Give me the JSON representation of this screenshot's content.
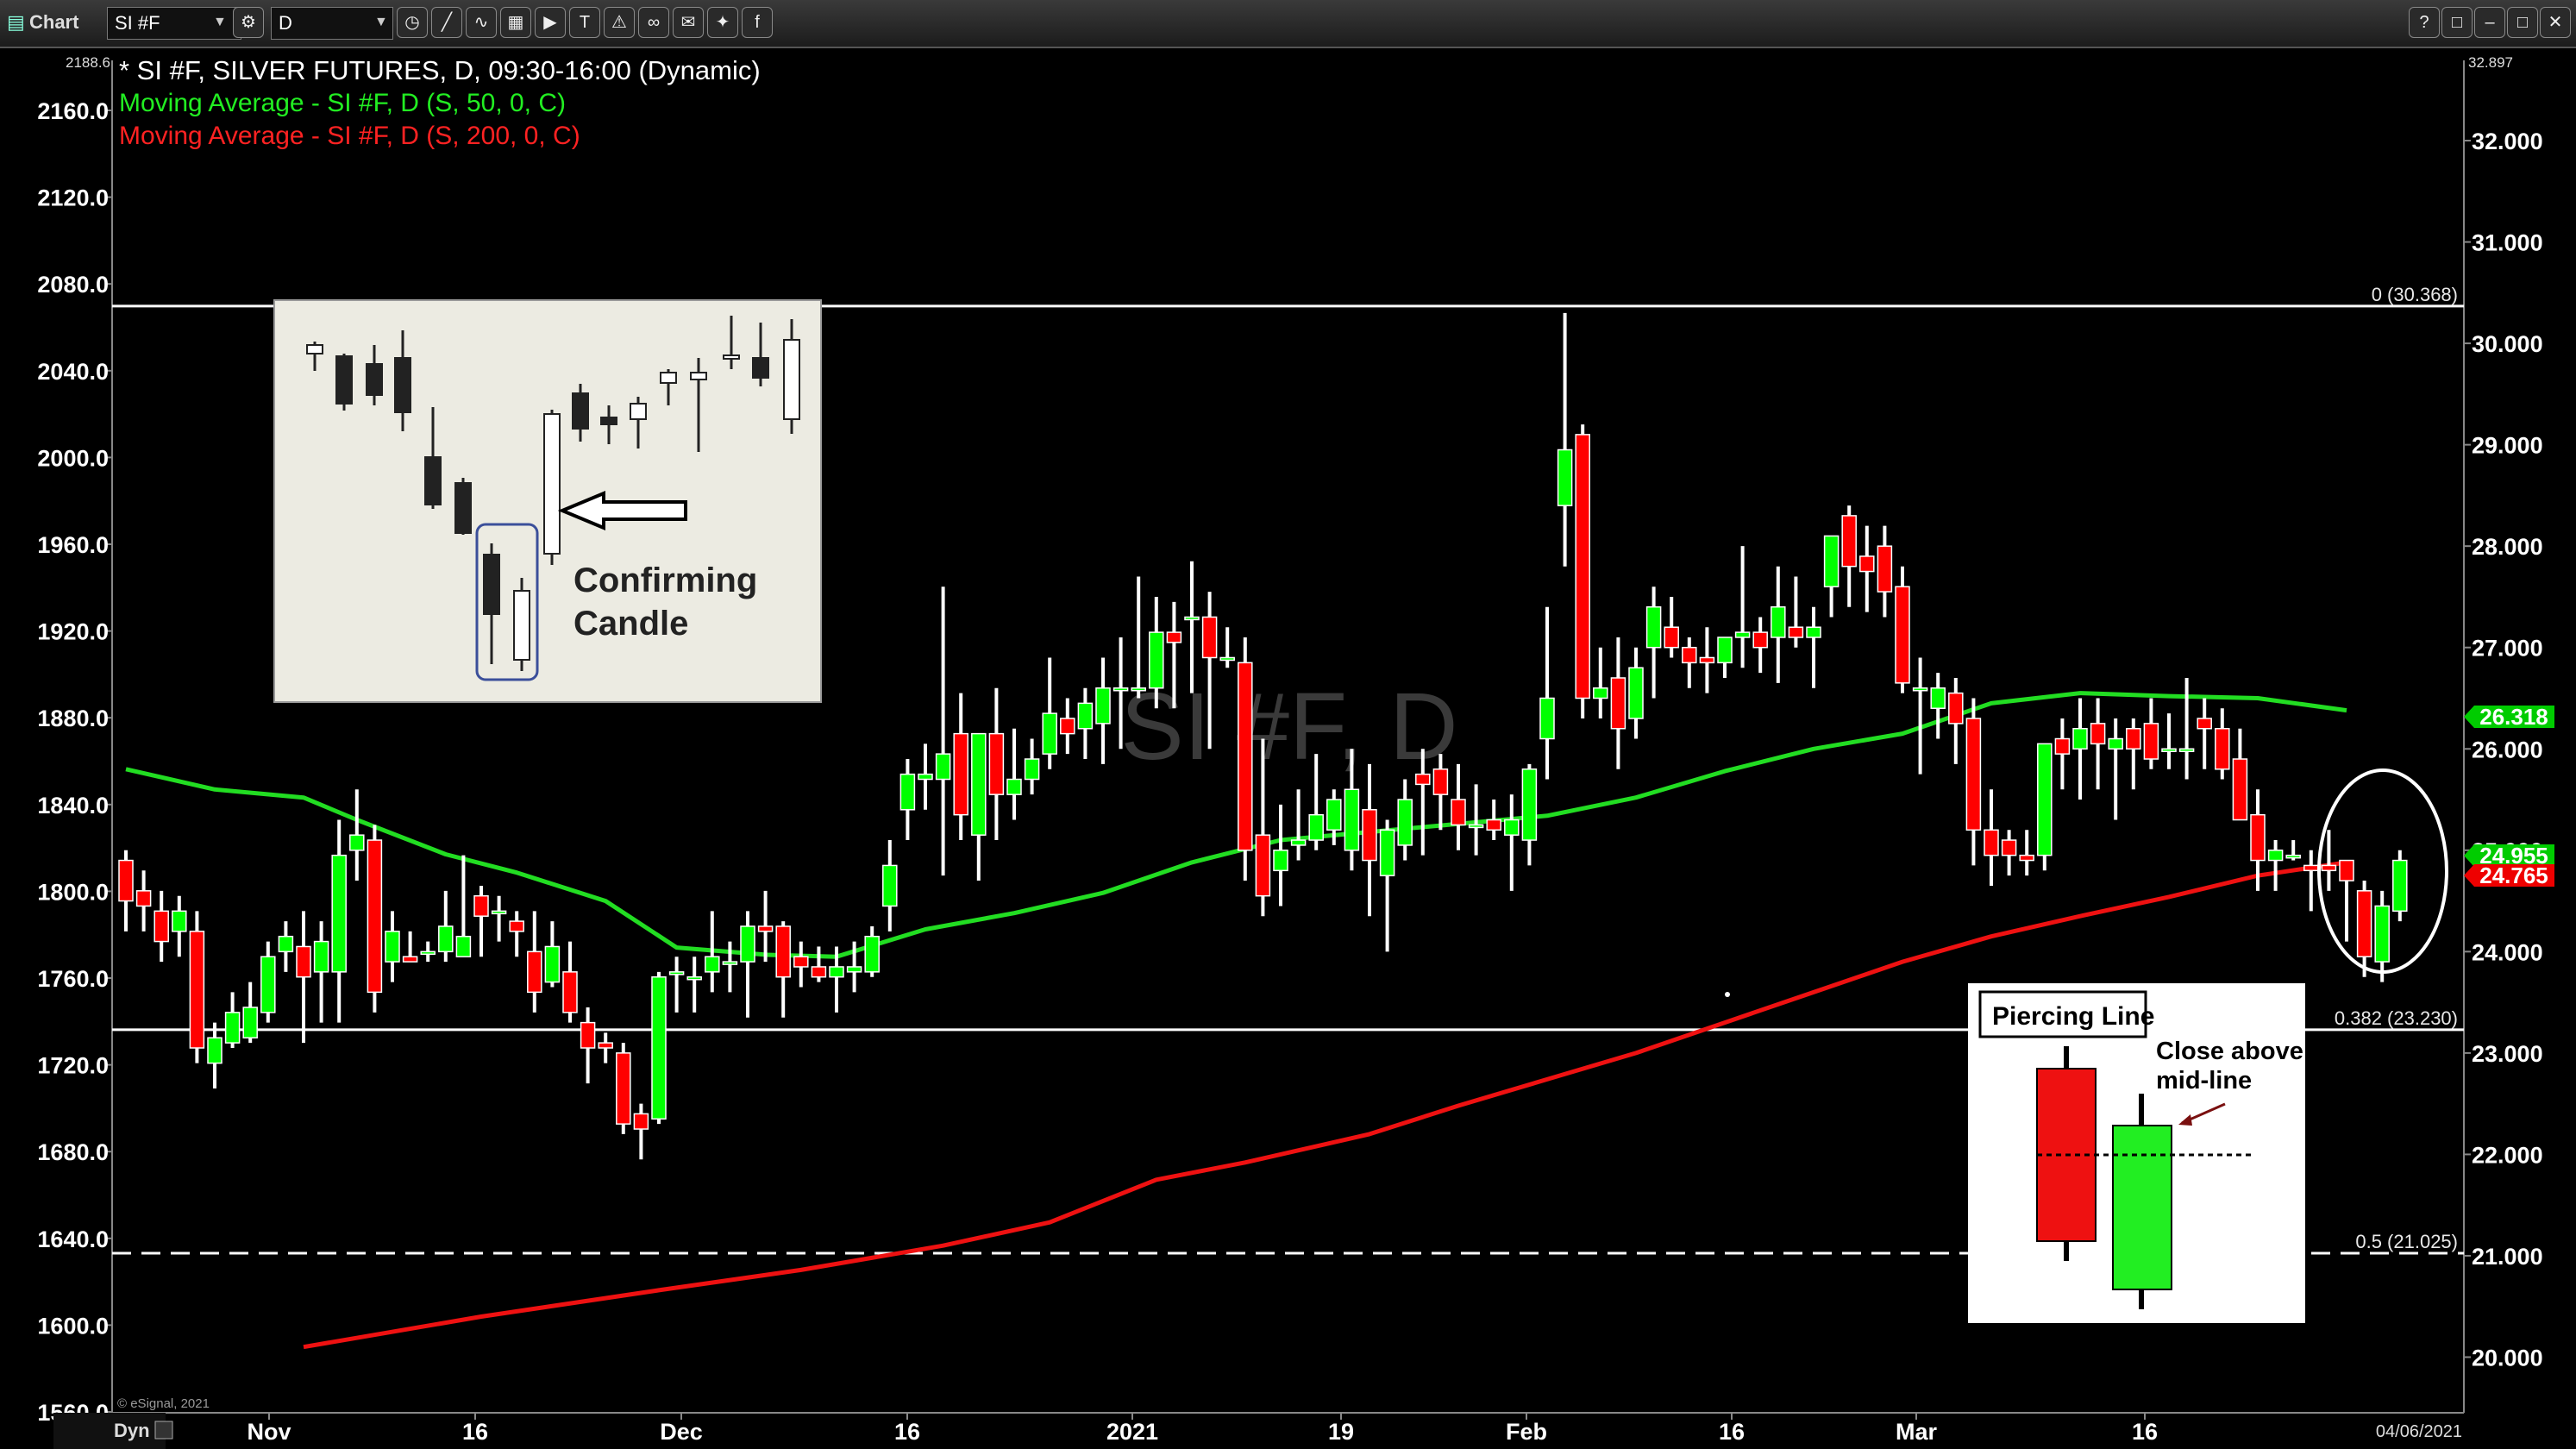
{
  "toolbar": {
    "app_label": "Chart",
    "symbol_value": "SI #F",
    "interval_value": "D",
    "window_controls": [
      "?",
      "□",
      "–",
      "□",
      "✕"
    ]
  },
  "header": {
    "title": "* SI #F, SILVER FUTURES, D, 09:30-16:00 (Dynamic)",
    "ma50": "Moving Average - SI #F, D (S, 50, 0, C)",
    "ma200": "Moving Average - SI #F, D (S, 200, 0, C)"
  },
  "watermark": "SI #F, D",
  "copyright": "© eSignal, 2021",
  "corner_label": "Dyn",
  "colors": {
    "up": "#00ff00",
    "down": "#ff0000",
    "ma50": "#22dd22",
    "ma200": "#ee1111",
    "white": "#ffffff"
  },
  "chart_data": {
    "type": "candlestick",
    "left_axis": {
      "ticks": [
        "2160.0",
        "2120.0",
        "2080.0",
        "2040.0",
        "2000.0",
        "1960.0",
        "1920.0",
        "1880.0",
        "1840.0",
        "1800.0",
        "1760.0",
        "1720.0",
        "1680.0",
        "1640.0",
        "1600.0",
        "1560.0"
      ],
      "top_label": "2188.6"
    },
    "right_axis": {
      "ticks": [
        "32.000",
        "31.000",
        "30.000",
        "29.000",
        "28.000",
        "27.000",
        "26.000",
        "25.000",
        "24.000",
        "23.000",
        "22.000",
        "21.000",
        "20.000"
      ],
      "top_label": "32.897",
      "ylim": [
        19.74,
        32.897
      ]
    },
    "x_axis": [
      "Nov",
      "16",
      "Dec",
      "16",
      "2021",
      "19",
      "Feb",
      "16",
      "Mar",
      "16"
    ],
    "date_label": "04/06/2021",
    "fib_levels": [
      {
        "label": "0 (30.368)",
        "value": 30.368,
        "style": "solid"
      },
      {
        "label": "0.382 (23.230)",
        "value": 23.23,
        "style": "solid"
      },
      {
        "label": "0.5 (21.025)",
        "value": 21.025,
        "style": "dashed"
      }
    ],
    "price_tags": [
      {
        "label": "26.318",
        "value": 26.318,
        "color": "#00cc00"
      },
      {
        "label": "24.955",
        "value": 24.955,
        "color": "#00cc00"
      },
      {
        "label": "24.765",
        "value": 24.765,
        "color": "#ee0000"
      }
    ],
    "candles": [
      {
        "o": 24.9,
        "h": 25.0,
        "l": 24.2,
        "c": 24.5
      },
      {
        "o": 24.6,
        "h": 24.8,
        "l": 24.2,
        "c": 24.45
      },
      {
        "o": 24.4,
        "h": 24.6,
        "l": 23.9,
        "c": 24.1
      },
      {
        "o": 24.2,
        "h": 24.55,
        "l": 23.95,
        "c": 24.4
      },
      {
        "o": 24.2,
        "h": 24.4,
        "l": 22.9,
        "c": 23.05
      },
      {
        "o": 22.9,
        "h": 23.3,
        "l": 22.65,
        "c": 23.15
      },
      {
        "o": 23.1,
        "h": 23.6,
        "l": 23.05,
        "c": 23.4
      },
      {
        "o": 23.15,
        "h": 23.7,
        "l": 23.1,
        "c": 23.45
      },
      {
        "o": 23.4,
        "h": 24.1,
        "l": 23.3,
        "c": 23.95
      },
      {
        "o": 24.0,
        "h": 24.3,
        "l": 23.8,
        "c": 24.15
      },
      {
        "o": 24.05,
        "h": 24.4,
        "l": 23.1,
        "c": 23.75
      },
      {
        "o": 23.8,
        "h": 24.3,
        "l": 23.3,
        "c": 24.1
      },
      {
        "o": 23.8,
        "h": 25.3,
        "l": 23.3,
        "c": 24.95
      },
      {
        "o": 25.0,
        "h": 25.6,
        "l": 24.7,
        "c": 25.15
      },
      {
        "o": 25.1,
        "h": 25.25,
        "l": 23.4,
        "c": 23.6
      },
      {
        "o": 23.9,
        "h": 24.4,
        "l": 23.7,
        "c": 24.2
      },
      {
        "o": 23.95,
        "h": 24.2,
        "l": 23.9,
        "c": 23.9
      },
      {
        "o": 24.0,
        "h": 24.1,
        "l": 23.9,
        "c": 24.0
      },
      {
        "o": 24.0,
        "h": 24.6,
        "l": 23.9,
        "c": 24.25
      },
      {
        "o": 23.95,
        "h": 24.95,
        "l": 23.95,
        "c": 24.15
      },
      {
        "o": 24.55,
        "h": 24.65,
        "l": 23.95,
        "c": 24.35
      },
      {
        "o": 24.4,
        "h": 24.55,
        "l": 24.1,
        "c": 24.4
      },
      {
        "o": 24.3,
        "h": 24.4,
        "l": 23.95,
        "c": 24.2
      },
      {
        "o": 24.0,
        "h": 24.4,
        "l": 23.4,
        "c": 23.6
      },
      {
        "o": 23.7,
        "h": 24.3,
        "l": 23.65,
        "c": 24.05
      },
      {
        "o": 23.8,
        "h": 24.1,
        "l": 23.3,
        "c": 23.4
      },
      {
        "o": 23.3,
        "h": 23.45,
        "l": 22.7,
        "c": 23.05
      },
      {
        "o": 23.1,
        "h": 23.2,
        "l": 22.9,
        "c": 23.05
      },
      {
        "o": 23.0,
        "h": 23.1,
        "l": 22.2,
        "c": 22.3
      },
      {
        "o": 22.4,
        "h": 22.5,
        "l": 21.95,
        "c": 22.25
      },
      {
        "o": 22.35,
        "h": 23.8,
        "l": 22.3,
        "c": 23.75
      },
      {
        "o": 23.8,
        "h": 23.95,
        "l": 23.4,
        "c": 23.8
      },
      {
        "o": 23.75,
        "h": 23.95,
        "l": 23.4,
        "c": 23.75
      },
      {
        "o": 23.8,
        "h": 24.4,
        "l": 23.6,
        "c": 23.95
      },
      {
        "o": 23.9,
        "h": 24.1,
        "l": 23.6,
        "c": 23.9
      },
      {
        "o": 23.9,
        "h": 24.4,
        "l": 23.35,
        "c": 24.25
      },
      {
        "o": 24.25,
        "h": 24.6,
        "l": 23.9,
        "c": 24.2
      },
      {
        "o": 24.25,
        "h": 24.3,
        "l": 23.35,
        "c": 23.75
      },
      {
        "o": 23.95,
        "h": 24.1,
        "l": 23.65,
        "c": 23.85
      },
      {
        "o": 23.85,
        "h": 24.05,
        "l": 23.7,
        "c": 23.75
      },
      {
        "o": 23.75,
        "h": 24.05,
        "l": 23.4,
        "c": 23.85
      },
      {
        "o": 23.8,
        "h": 24.1,
        "l": 23.6,
        "c": 23.85
      },
      {
        "o": 23.8,
        "h": 24.25,
        "l": 23.75,
        "c": 24.15
      },
      {
        "o": 24.45,
        "h": 25.1,
        "l": 24.2,
        "c": 24.85
      },
      {
        "o": 25.4,
        "h": 25.9,
        "l": 25.1,
        "c": 25.75
      },
      {
        "o": 25.7,
        "h": 26.05,
        "l": 25.4,
        "c": 25.75
      },
      {
        "o": 25.7,
        "h": 27.6,
        "l": 24.75,
        "c": 25.95
      },
      {
        "o": 26.15,
        "h": 26.55,
        "l": 25.1,
        "c": 25.35
      },
      {
        "o": 25.15,
        "h": 25.95,
        "l": 24.7,
        "c": 26.15
      },
      {
        "o": 26.15,
        "h": 26.6,
        "l": 25.1,
        "c": 25.55
      },
      {
        "o": 25.55,
        "h": 26.2,
        "l": 25.3,
        "c": 25.7
      },
      {
        "o": 25.7,
        "h": 26.1,
        "l": 25.55,
        "c": 25.9
      },
      {
        "o": 25.95,
        "h": 26.9,
        "l": 25.8,
        "c": 26.35
      },
      {
        "o": 26.3,
        "h": 26.5,
        "l": 25.95,
        "c": 26.15
      },
      {
        "o": 26.2,
        "h": 26.6,
        "l": 25.9,
        "c": 26.45
      },
      {
        "o": 26.25,
        "h": 26.9,
        "l": 25.85,
        "c": 26.6
      },
      {
        "o": 26.6,
        "h": 27.1,
        "l": 26.0,
        "c": 26.6
      },
      {
        "o": 26.6,
        "h": 27.7,
        "l": 26.5,
        "c": 26.6
      },
      {
        "o": 26.6,
        "h": 27.5,
        "l": 26.4,
        "c": 27.15
      },
      {
        "o": 27.15,
        "h": 27.45,
        "l": 26.4,
        "c": 27.05
      },
      {
        "o": 27.3,
        "h": 27.85,
        "l": 26.55,
        "c": 27.3
      },
      {
        "o": 27.3,
        "h": 27.55,
        "l": 26.0,
        "c": 26.9
      },
      {
        "o": 26.9,
        "h": 27.2,
        "l": 26.8,
        "c": 26.9
      },
      {
        "o": 26.85,
        "h": 27.1,
        "l": 24.7,
        "c": 25.0
      },
      {
        "o": 25.15,
        "h": 26.1,
        "l": 24.35,
        "c": 24.55
      },
      {
        "o": 24.8,
        "h": 25.45,
        "l": 24.45,
        "c": 25.0
      },
      {
        "o": 25.05,
        "h": 25.6,
        "l": 24.9,
        "c": 25.1
      },
      {
        "o": 25.1,
        "h": 25.95,
        "l": 25.0,
        "c": 25.35
      },
      {
        "o": 25.2,
        "h": 25.6,
        "l": 25.05,
        "c": 25.5
      },
      {
        "o": 25.0,
        "h": 26.0,
        "l": 24.8,
        "c": 25.6
      },
      {
        "o": 25.4,
        "h": 25.85,
        "l": 24.35,
        "c": 24.9
      },
      {
        "o": 24.75,
        "h": 25.3,
        "l": 24.0,
        "c": 25.2
      },
      {
        "o": 25.05,
        "h": 25.7,
        "l": 24.9,
        "c": 25.5
      },
      {
        "o": 25.75,
        "h": 26.0,
        "l": 24.95,
        "c": 25.65
      },
      {
        "o": 25.8,
        "h": 25.95,
        "l": 25.2,
        "c": 25.55
      },
      {
        "o": 25.5,
        "h": 25.85,
        "l": 25.0,
        "c": 25.25
      },
      {
        "o": 25.25,
        "h": 25.65,
        "l": 24.95,
        "c": 25.25
      },
      {
        "o": 25.3,
        "h": 25.5,
        "l": 25.1,
        "c": 25.2
      },
      {
        "o": 25.15,
        "h": 25.55,
        "l": 24.6,
        "c": 25.3
      },
      {
        "o": 25.1,
        "h": 25.85,
        "l": 24.85,
        "c": 25.8
      },
      {
        "o": 26.1,
        "h": 27.4,
        "l": 25.7,
        "c": 26.5
      },
      {
        "o": 28.4,
        "h": 30.3,
        "l": 27.8,
        "c": 28.95
      },
      {
        "o": 29.1,
        "h": 29.2,
        "l": 26.3,
        "c": 26.5
      },
      {
        "o": 26.5,
        "h": 27.0,
        "l": 26.3,
        "c": 26.6
      },
      {
        "o": 26.7,
        "h": 27.1,
        "l": 25.8,
        "c": 26.2
      },
      {
        "o": 26.3,
        "h": 27.0,
        "l": 26.1,
        "c": 26.8
      },
      {
        "o": 27.0,
        "h": 27.6,
        "l": 26.5,
        "c": 27.4
      },
      {
        "o": 27.2,
        "h": 27.5,
        "l": 26.9,
        "c": 27.0
      },
      {
        "o": 27.0,
        "h": 27.1,
        "l": 26.6,
        "c": 26.85
      },
      {
        "o": 26.9,
        "h": 27.2,
        "l": 26.55,
        "c": 26.85
      },
      {
        "o": 26.85,
        "h": 27.1,
        "l": 26.7,
        "c": 27.1
      },
      {
        "o": 27.1,
        "h": 28.0,
        "l": 26.8,
        "c": 27.15
      },
      {
        "o": 27.15,
        "h": 27.3,
        "l": 26.75,
        "c": 27.0
      },
      {
        "o": 27.1,
        "h": 27.8,
        "l": 26.65,
        "c": 27.4
      },
      {
        "o": 27.2,
        "h": 27.7,
        "l": 27.0,
        "c": 27.1
      },
      {
        "o": 27.1,
        "h": 27.4,
        "l": 26.6,
        "c": 27.2
      },
      {
        "o": 27.6,
        "h": 28.1,
        "l": 27.3,
        "c": 28.1
      },
      {
        "o": 28.3,
        "h": 28.4,
        "l": 27.4,
        "c": 27.8
      },
      {
        "o": 27.9,
        "h": 28.2,
        "l": 27.35,
        "c": 27.75
      },
      {
        "o": 28.0,
        "h": 28.2,
        "l": 27.3,
        "c": 27.55
      },
      {
        "o": 27.6,
        "h": 27.8,
        "l": 26.55,
        "c": 26.65
      },
      {
        "o": 26.6,
        "h": 26.9,
        "l": 25.75,
        "c": 26.6
      },
      {
        "o": 26.4,
        "h": 26.75,
        "l": 26.1,
        "c": 26.6
      },
      {
        "o": 26.55,
        "h": 26.7,
        "l": 25.85,
        "c": 26.25
      },
      {
        "o": 26.3,
        "h": 26.5,
        "l": 24.85,
        "c": 25.2
      },
      {
        "o": 25.2,
        "h": 25.6,
        "l": 24.65,
        "c": 24.95
      },
      {
        "o": 25.1,
        "h": 25.2,
        "l": 24.75,
        "c": 24.95
      },
      {
        "o": 24.95,
        "h": 25.2,
        "l": 24.75,
        "c": 24.9
      },
      {
        "o": 24.95,
        "h": 25.6,
        "l": 24.8,
        "c": 26.05
      },
      {
        "o": 26.1,
        "h": 26.3,
        "l": 25.6,
        "c": 25.95
      },
      {
        "o": 26.0,
        "h": 26.5,
        "l": 25.5,
        "c": 26.2
      },
      {
        "o": 26.25,
        "h": 26.5,
        "l": 25.6,
        "c": 26.05
      },
      {
        "o": 26.0,
        "h": 26.3,
        "l": 25.3,
        "c": 26.1
      },
      {
        "o": 26.2,
        "h": 26.3,
        "l": 25.6,
        "c": 26.0
      },
      {
        "o": 26.25,
        "h": 26.5,
        "l": 25.8,
        "c": 25.9
      },
      {
        "o": 26.0,
        "h": 26.35,
        "l": 25.8,
        "c": 26.0
      },
      {
        "o": 26.0,
        "h": 26.7,
        "l": 25.7,
        "c": 26.0
      },
      {
        "o": 26.3,
        "h": 26.5,
        "l": 25.8,
        "c": 26.2
      },
      {
        "o": 26.2,
        "h": 26.4,
        "l": 25.7,
        "c": 25.8
      },
      {
        "o": 25.9,
        "h": 26.2,
        "l": 25.4,
        "c": 25.3
      },
      {
        "o": 25.35,
        "h": 25.6,
        "l": 24.6,
        "c": 24.9
      },
      {
        "o": 24.9,
        "h": 25.1,
        "l": 24.6,
        "c": 25.0
      },
      {
        "o": 24.95,
        "h": 25.1,
        "l": 24.9,
        "c": 24.95
      },
      {
        "o": 24.85,
        "h": 25.0,
        "l": 24.4,
        "c": 24.8
      },
      {
        "o": 24.85,
        "h": 25.2,
        "l": 24.6,
        "c": 24.8
      },
      {
        "o": 24.9,
        "h": 24.9,
        "l": 24.1,
        "c": 24.7
      },
      {
        "o": 24.6,
        "h": 24.7,
        "l": 23.75,
        "c": 23.95
      },
      {
        "o": 23.9,
        "h": 24.6,
        "l": 23.7,
        "c": 24.45
      },
      {
        "o": 24.4,
        "h": 25.0,
        "l": 24.3,
        "c": 24.9
      }
    ],
    "ma50": [
      [
        0,
        25.8
      ],
      [
        2,
        25.72
      ],
      [
        5,
        25.6
      ],
      [
        10,
        25.52
      ],
      [
        13,
        25.3
      ],
      [
        18,
        24.96
      ],
      [
        22,
        24.78
      ],
      [
        27,
        24.5
      ],
      [
        31,
        24.04
      ],
      [
        36,
        23.97
      ],
      [
        40,
        23.95
      ],
      [
        45,
        24.22
      ],
      [
        50,
        24.38
      ],
      [
        55,
        24.58
      ],
      [
        60,
        24.88
      ],
      [
        65,
        25.1
      ],
      [
        70,
        25.18
      ],
      [
        75,
        25.26
      ],
      [
        80,
        25.34
      ],
      [
        85,
        25.52
      ],
      [
        90,
        25.78
      ],
      [
        95,
        26.0
      ],
      [
        100,
        26.15
      ],
      [
        105,
        26.45
      ],
      [
        110,
        26.55
      ],
      [
        115,
        26.52
      ],
      [
        120,
        26.5
      ],
      [
        125,
        26.38
      ]
    ],
    "ma200": [
      [
        10,
        20.1
      ],
      [
        20,
        20.4
      ],
      [
        30,
        20.66
      ],
      [
        38,
        20.86
      ],
      [
        46,
        21.1
      ],
      [
        52,
        21.33
      ],
      [
        58,
        21.75
      ],
      [
        63,
        21.92
      ],
      [
        70,
        22.2
      ],
      [
        75,
        22.48
      ],
      [
        80,
        22.74
      ],
      [
        85,
        23.0
      ],
      [
        90,
        23.3
      ],
      [
        95,
        23.6
      ],
      [
        100,
        23.9
      ],
      [
        105,
        24.15
      ],
      [
        110,
        24.35
      ],
      [
        115,
        24.54
      ],
      [
        120,
        24.75
      ],
      [
        125,
        24.88
      ]
    ]
  },
  "inset_confirming": {
    "label_line1": "Confirming",
    "label_line2": "Candle"
  },
  "inset_piercing": {
    "title": "Piercing Line",
    "note_line1": "Close above",
    "note_line2": "mid-line"
  }
}
